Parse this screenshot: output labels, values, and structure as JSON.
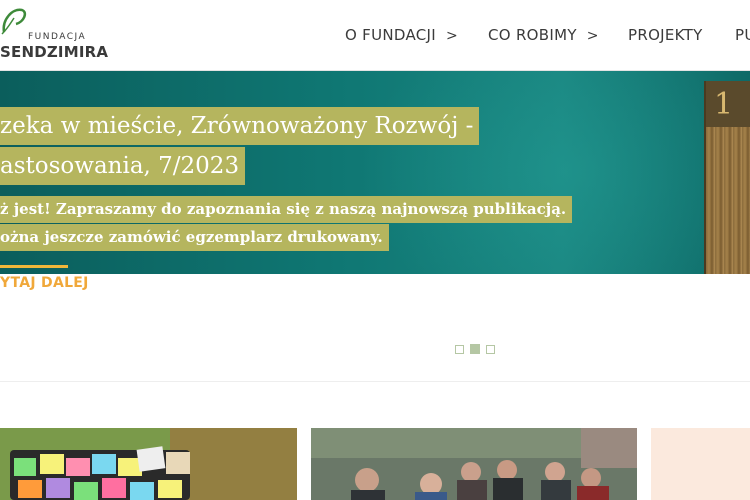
{
  "logo": {
    "small_text": "FUNDACJA",
    "big_text": "SENDZIMIRA"
  },
  "nav": {
    "items": [
      {
        "label": "O FUNDACJI",
        "has_submenu": true
      },
      {
        "label": "CO ROBIMY",
        "has_submenu": true
      },
      {
        "label": "PROJEKTY",
        "has_submenu": false
      },
      {
        "label": "PU",
        "has_submenu": false
      }
    ],
    "chevron": ">"
  },
  "hero": {
    "title_line1": "zeka w mieście, Zrównoważony Rozwój -",
    "title_line2": "astosowania, 7/2023",
    "desc_line1": "ż jest! Zapraszamy do zapoznania się z naszą najnowszą publikacją.",
    "desc_line2": "ożna jeszcze zamówić egzemplarz drukowany.",
    "read_more": "YTAJ DALEJ",
    "book_number": "1",
    "background_color": "#0f7773",
    "highlight_color": "#b5b55e",
    "accent_color": "#f0a83a"
  },
  "slider": {
    "dot_count": 3,
    "active_index": 1
  },
  "cards": [
    {
      "name": "card-sticky-notes"
    },
    {
      "name": "card-group-photo"
    },
    {
      "name": "card-peach"
    }
  ]
}
